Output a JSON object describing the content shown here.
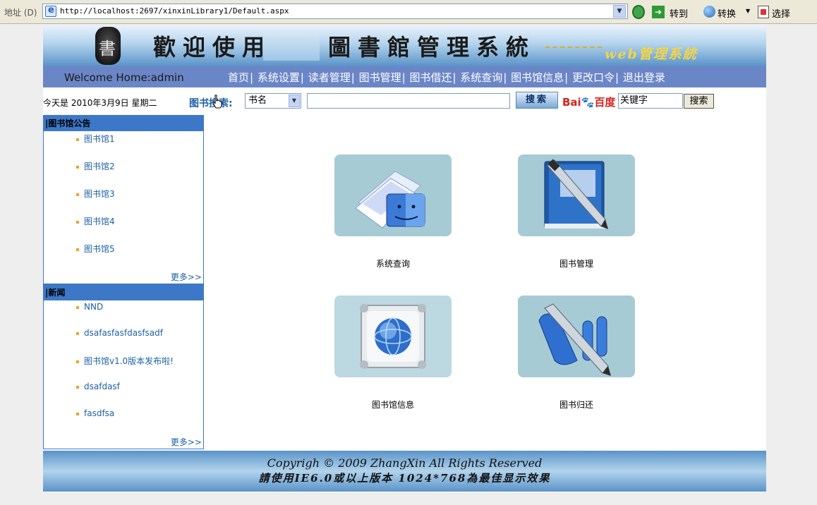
{
  "browser": {
    "address_label": "地址 (D)",
    "url": "http://localhost:2697/xinxinLibrary1/Default.aspx",
    "go_label": "转到",
    "convert_label": "转换",
    "select_label": "选择"
  },
  "banner": {
    "title_part1": "歡迎使用",
    "title_part2": "圖書館管理系統",
    "subtitle": "web管理系統"
  },
  "navbar": {
    "welcome": "Welcome Home:admin",
    "links": [
      "首页",
      "系统设置",
      "读者管理",
      "图书管理",
      "图书借还",
      "系统查询",
      "图书馆信息",
      "更改口令",
      "退出登录"
    ]
  },
  "search": {
    "date_text": "今天是  2010年3月9日 星期二",
    "label": "图书搜索:",
    "field_selected": "书名",
    "query": "",
    "button": "搜索",
    "baidu_logo": "Bai",
    "baidu_logo_tail": "百度",
    "keyword_value": "关键字",
    "baidu_button": "搜索"
  },
  "announcements": {
    "title": "|图书馆公告",
    "items": [
      "图书馆1",
      "图书馆2",
      "图书馆3",
      "图书馆4",
      "图书馆5"
    ],
    "more": "更多>>"
  },
  "news": {
    "title": "|新闻",
    "items": [
      "NND",
      "dsafasfasfdasfsadf",
      "图书馆v1.0版本发布啦!",
      "dsafdasf",
      "fasdfsa"
    ],
    "more": "更多>>"
  },
  "tiles": [
    {
      "label": "系统查询",
      "icon": "finder-docs-icon"
    },
    {
      "label": "图书管理",
      "icon": "book-pen-icon"
    },
    {
      "label": "图书馆信息",
      "icon": "globe-frame-icon"
    },
    {
      "label": "图书归还",
      "icon": "pen-paper-icon"
    }
  ],
  "footer": {
    "line1": "Copyrigh © 2009 ZhangXin     All Rights Reserved",
    "line2": "請使用IE6.0或以上版本  1024*768為最佳显示效果"
  }
}
